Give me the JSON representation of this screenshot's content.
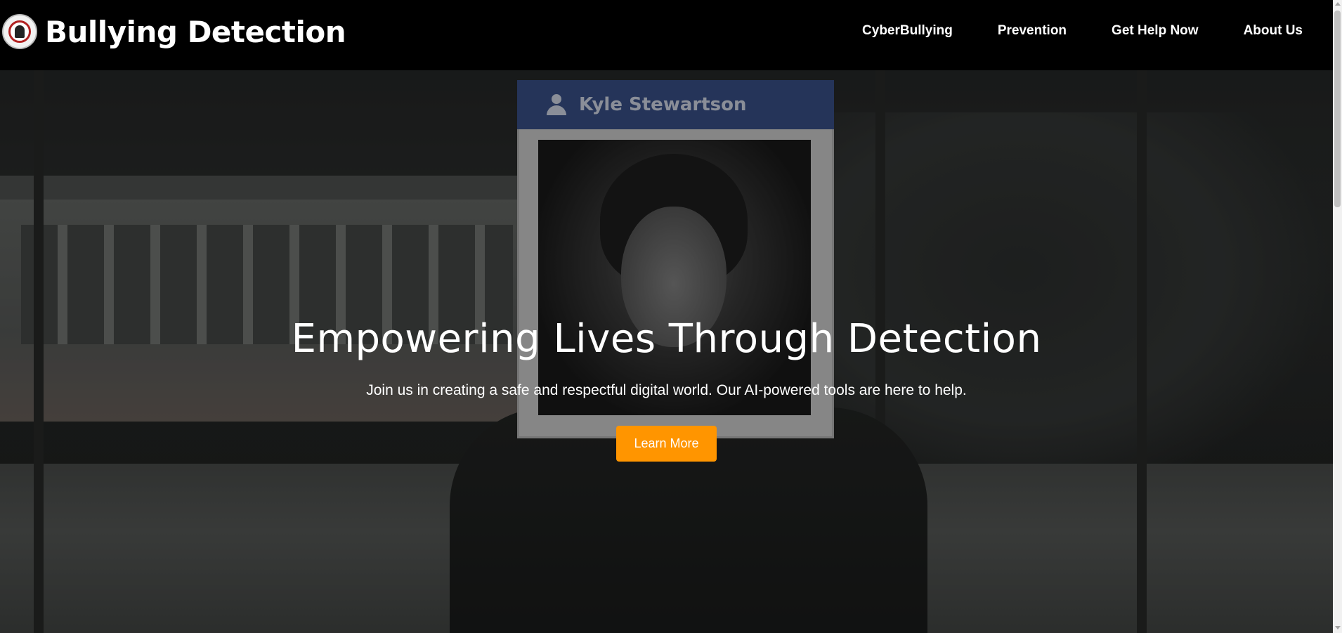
{
  "header": {
    "brand": "Bullying Detection",
    "nav": [
      {
        "label": "CyberBullying"
      },
      {
        "label": "Prevention"
      },
      {
        "label": "Get Help Now"
      },
      {
        "label": "About Us"
      }
    ]
  },
  "hero": {
    "card_name": "Kyle Stewartson",
    "title": "Empowering Lives Through Detection",
    "subtitle": "Join us in creating a safe and respectful digital world. Our AI-powered tools are here to help.",
    "cta_label": "Learn More"
  },
  "colors": {
    "accent": "#ff9500",
    "header_bg": "#000000",
    "card_header": "#3c5590"
  }
}
